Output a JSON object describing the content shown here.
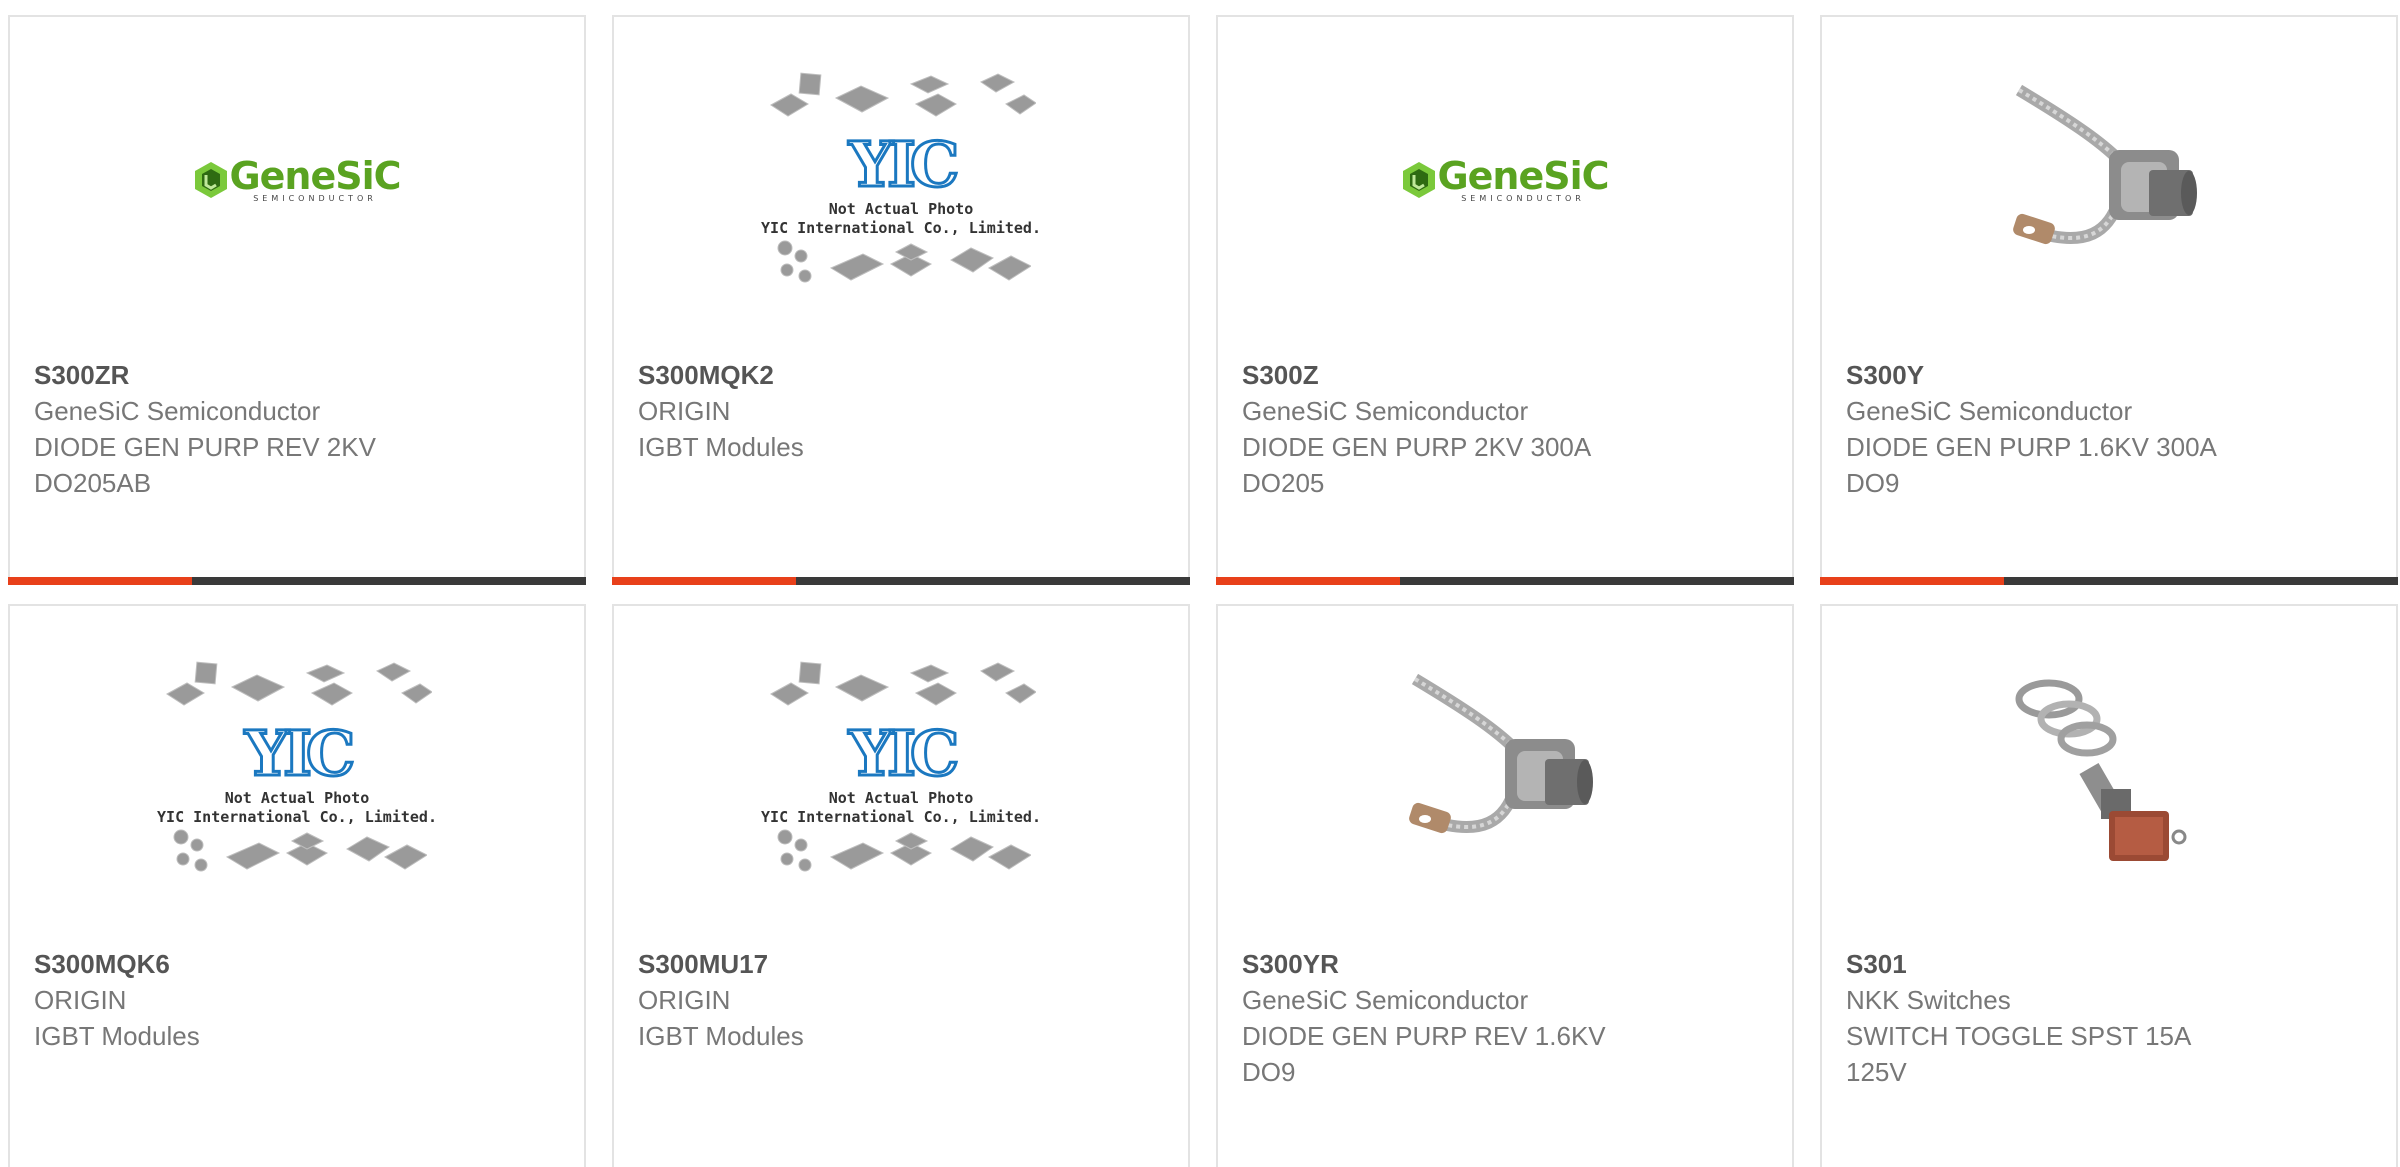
{
  "products": [
    {
      "part": "S300ZR",
      "maker": "GeneSiC Semiconductor",
      "desc": [
        "DIODE GEN PURP REV 2KV",
        "DO205AB"
      ],
      "image": "genesic-logo"
    },
    {
      "part": "S300MQK2",
      "maker": "ORIGIN",
      "desc": [
        "IGBT Modules"
      ],
      "image": "yic-placeholder"
    },
    {
      "part": "S300Z",
      "maker": "GeneSiC Semiconductor",
      "desc": [
        "DIODE GEN PURP 2KV 300A",
        "DO205"
      ],
      "image": "genesic-logo"
    },
    {
      "part": "S300Y",
      "maker": "GeneSiC Semiconductor",
      "desc": [
        "DIODE GEN PURP 1.6KV 300A",
        "DO9"
      ],
      "image": "stud-diode-photo"
    },
    {
      "part": "S300MQK6",
      "maker": "ORIGIN",
      "desc": [
        "IGBT Modules"
      ],
      "image": "yic-placeholder"
    },
    {
      "part": "S300MU17",
      "maker": "ORIGIN",
      "desc": [
        "IGBT Modules"
      ],
      "image": "yic-placeholder"
    },
    {
      "part": "S300YR",
      "maker": "GeneSiC Semiconductor",
      "desc": [
        "DIODE GEN PURP REV 1.6KV",
        "DO9"
      ],
      "image": "stud-diode-photo"
    },
    {
      "part": "S301",
      "maker": "NKK Switches",
      "desc": [
        "SWITCH TOGGLE SPST 15A",
        "125V"
      ],
      "image": "toggle-switch-photo"
    }
  ],
  "logos": {
    "genesic_name": "GeneSiC",
    "genesic_sub": "SEMICONDUCTOR",
    "yic_name": "YIC",
    "yic_caption1": "Not Actual Photo",
    "yic_caption2": "YIC International Co., Limited."
  },
  "colors": {
    "accent": "#e8401a",
    "bar": "#3a3a3a",
    "genesic_green": "#5aa321",
    "yic_blue": "#1b78c0"
  }
}
